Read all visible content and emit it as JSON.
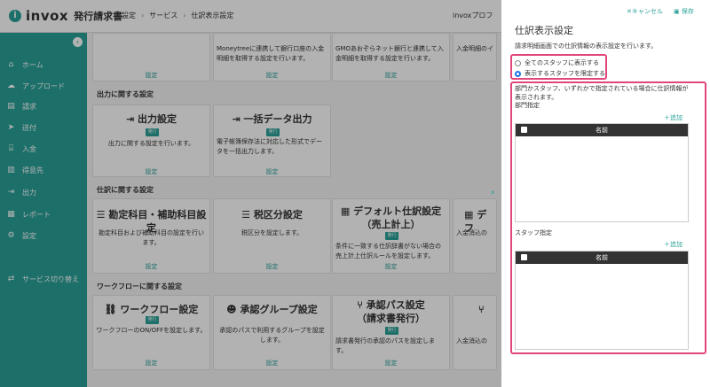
{
  "header": {
    "logo_mark": "i",
    "logo_text": "invox",
    "logo_sub": "発行請求書",
    "breadcrumb": [
      "設定",
      "サービス",
      "仕訳表示設定"
    ],
    "user": "invoxプロフ"
  },
  "sidebar": {
    "collapse_icon": "chevron-left-icon",
    "items": [
      {
        "label": "ホーム",
        "icon": "home-icon"
      },
      {
        "label": "アップロード",
        "icon": "cloud-upload-icon"
      },
      {
        "label": "請求",
        "icon": "document-icon"
      },
      {
        "label": "送付",
        "icon": "send-icon"
      },
      {
        "label": "入金",
        "icon": "bank-icon"
      },
      {
        "label": "得意先",
        "icon": "building-icon"
      },
      {
        "label": "出力",
        "icon": "export-icon"
      },
      {
        "label": "レポート",
        "icon": "chart-icon"
      },
      {
        "label": "設定",
        "icon": "gear-icon"
      },
      {
        "label": "サービス切り替え",
        "icon": "switch-icon"
      }
    ]
  },
  "main": {
    "top_row": [
      {
        "desc": "Moneytreeに連携して銀行口座の入金明細を取得する設定を行います。",
        "link": "設定"
      },
      {
        "desc": "GMOあおぞらネット銀行と連携して入金明細を取得する設定を行います。",
        "link": "設定"
      },
      {
        "desc": "入金明細のイ",
        "link": ""
      }
    ],
    "sections": [
      {
        "title": "出力に関する設定"
      },
      {
        "title": "仕訳に関する設定"
      },
      {
        "title": "ワークフローに関する設定"
      }
    ],
    "output_cards": [
      {
        "title": "出力設定",
        "icon": "export-icon",
        "badge": "発行",
        "desc": "出力に関する設定を行います。",
        "link": "設定"
      },
      {
        "title": "一括データ出力",
        "icon": "export-icon",
        "badge": "発行",
        "desc": "電子帳簿保存法に対応した形式でデータを一括出力します。",
        "link": "設定"
      }
    ],
    "journal_cards": [
      {
        "title": "勘定科目・補助科目設定",
        "icon": "list-icon",
        "badge": "",
        "desc": "勘定科目および補助科目の設定を行います。",
        "link": "設定"
      },
      {
        "title": "税区分設定",
        "icon": "list-icon",
        "badge": "",
        "desc": "税区分を設定します。",
        "link": "設定"
      },
      {
        "title": "デフォルト仕訳設定",
        "title2": "（売上計上）",
        "icon": "table-icon",
        "badge": "発行",
        "desc": "条件に一致する仕訳辞書がない場合の売上計上仕訳ルールを設定します。",
        "link": "設定"
      },
      {
        "title": "デフ",
        "icon": "table-icon",
        "badge": "",
        "desc": "入金消込の",
        "link": ""
      }
    ],
    "workflow_cards": [
      {
        "title": "ワークフロー設定",
        "icon": "workflow-icon",
        "badge": "発行",
        "desc": "ワークフローのON/OFFを設定します。",
        "link": "設定"
      },
      {
        "title": "承認グループ設定",
        "icon": "users-icon",
        "badge": "",
        "desc": "承認のパスで利用するグループを設定します。",
        "link": "設定"
      },
      {
        "title": "承認パス設定",
        "title2": "（請求書発行）",
        "icon": "branch-icon",
        "badge": "発行",
        "desc": "請求書発行の承認のパスを設定します。",
        "link": "設定"
      },
      {
        "title": "",
        "icon": "branch-icon",
        "badge": "",
        "desc": "入金消込の",
        "link": ""
      }
    ],
    "expand_icon": "chevron-right-icon"
  },
  "panel": {
    "cancel": "✕キャンセル",
    "save": "保存",
    "title": "仕訳表示設定",
    "desc": "請求明細画面での仕訳情報の表示設定を行います。",
    "radio_all": "全てのスタッフに表示する",
    "radio_limited": "表示するスタッフを限定する",
    "note": "部門かスタッフ、いずれかで指定されている場合に仕訳情報が表示されます。",
    "dept_label": "部門指定",
    "staff_label": "スタッフ指定",
    "add": "＋追加",
    "name_col": "名前",
    "highlight_color": "#e0457b",
    "accent_color": "#2aa198"
  }
}
